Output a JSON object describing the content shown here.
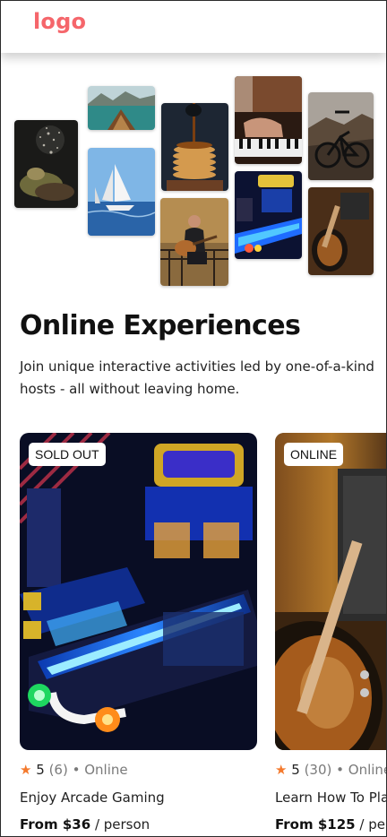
{
  "header": {
    "logo_text": "logo"
  },
  "hero": {
    "title": "Online Experiences",
    "subtitle": "Join unique interactive activities led by one-of-a-kind hosts - all without leaving home."
  },
  "collage_images": [
    "water-splash-rock-photo",
    "boat-on-lake-photo",
    "sailboat-photo",
    "pancakes-syrup-photo",
    "guitar-player-photo",
    "piano-keys-photo",
    "arcade-bowling-photo",
    "mountain-bike-photo",
    "electric-guitar-photo"
  ],
  "cards": [
    {
      "badge": "SOLD OUT",
      "rating": "5",
      "review_count": "(6)",
      "separator": "•",
      "location": "Online",
      "title": "Enjoy Arcade Gaming",
      "price_label": "From $36",
      "price_unit": "/ person"
    },
    {
      "badge": "ONLINE",
      "rating": "5",
      "review_count": "(30)",
      "separator": "•",
      "location": "Online",
      "title": "Learn How To Play Guitar",
      "price_label": "From $125",
      "price_unit": "/ person"
    }
  ],
  "colors": {
    "brand": "#F5666B",
    "star": "#F4792C"
  },
  "icons": {
    "star": "star-icon"
  }
}
